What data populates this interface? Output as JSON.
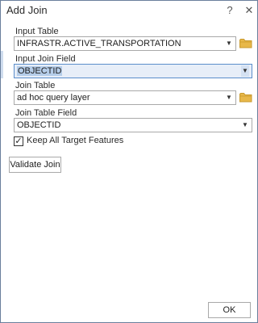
{
  "window": {
    "title": "Add Join",
    "help_glyph": "?",
    "close_glyph": "✕"
  },
  "form": {
    "input_table": {
      "label": "Input Table",
      "value": "INFRASTR.ACTIVE_TRANSPORTATION"
    },
    "input_join_field": {
      "label": "Input Join Field",
      "value": "OBJECTID"
    },
    "join_table": {
      "label": "Join Table",
      "value": "ad hoc query layer"
    },
    "join_table_field": {
      "label": "Join Table Field",
      "value": "OBJECTID"
    },
    "keep_all": {
      "label": "Keep All Target Features",
      "checked": true,
      "check_glyph": "✓"
    }
  },
  "buttons": {
    "validate_label": "Validate Join",
    "ok_label": "OK"
  },
  "icons": {
    "dropdown": "chevron-down-icon",
    "browse": "folder-icon"
  },
  "colors": {
    "folder": "#e8b84a",
    "folder_dark": "#c99a2e",
    "active_border": "#5b8ecb",
    "selection": "#b5cde9"
  }
}
